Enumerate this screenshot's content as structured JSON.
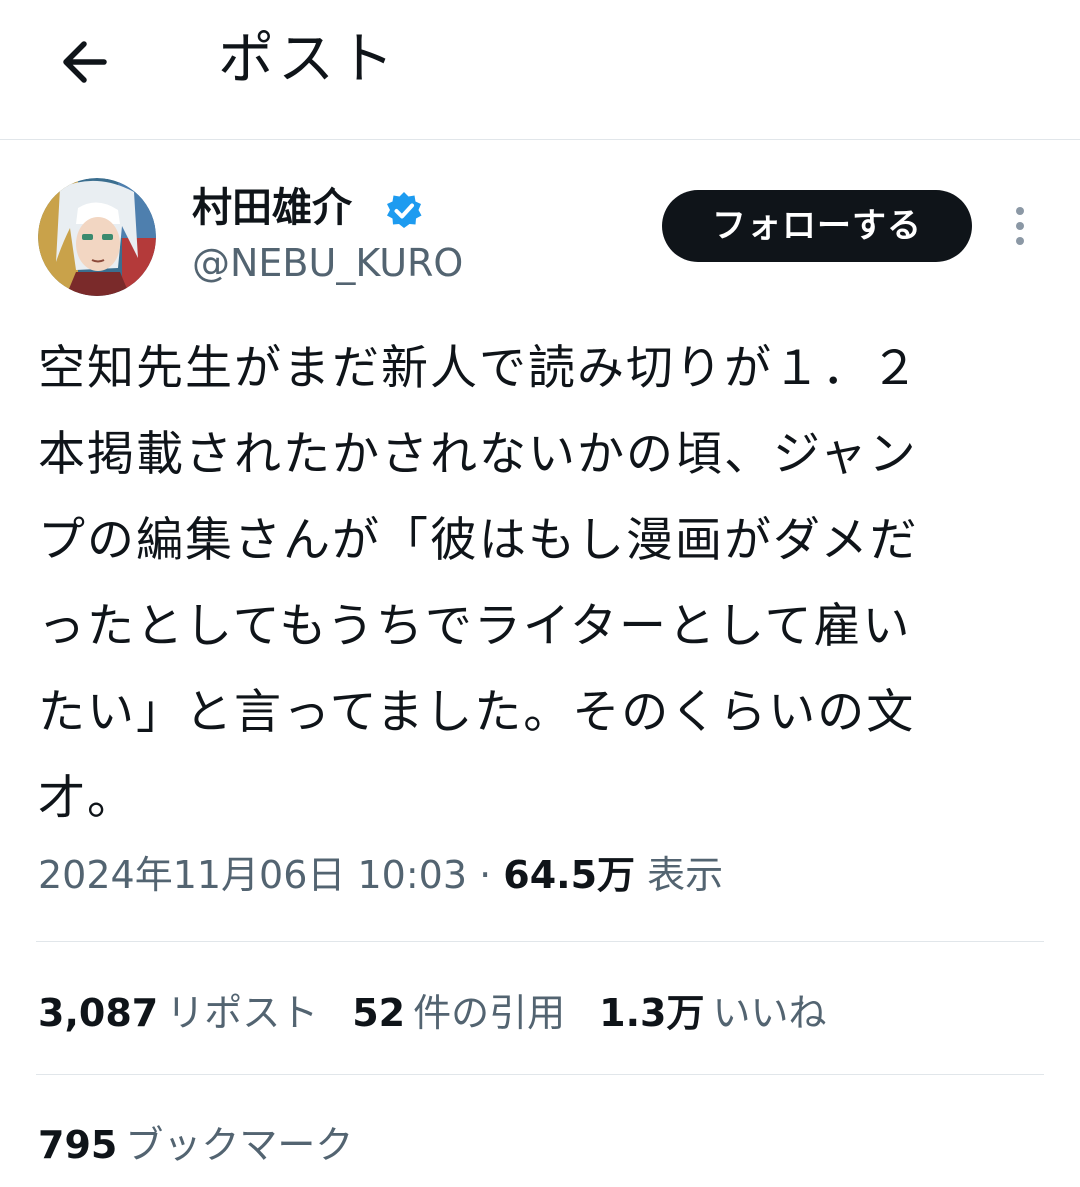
{
  "header": {
    "back_icon": "arrow-left-icon",
    "title": "ポスト"
  },
  "author": {
    "display_name": "村田雄介",
    "handle": "@NEBU_KURO",
    "verified": true,
    "verified_icon": "verified-badge-icon",
    "avatar_icon": "avatar-anime-character",
    "badge_color": "#1d9bf0"
  },
  "actions": {
    "follow_label": "フォローする",
    "more_icon": "more-vertical-icon"
  },
  "tweet": {
    "lines": [
      "空知先生がまだ新人で読み切りが１．２",
      "本掲載されたかされないかの頃、ジャン",
      "プの編集さんが「彼はもし漫画がダメだ",
      "ったとしてもうちでライターとして雇い",
      "たい」と言ってました。そのくらいの文",
      "才。"
    ]
  },
  "meta": {
    "timestamp": "2024年11月06日 10:03",
    "separator": "·",
    "views_count": "64.5万",
    "views_label": "表示"
  },
  "stats": {
    "reposts_count": "3,087",
    "reposts_label": "リポスト",
    "quotes_count": "52",
    "quotes_label": "件の引用",
    "likes_count": "1.3万",
    "likes_label": "いいね",
    "bookmarks_count": "795",
    "bookmarks_label": "ブックマーク"
  }
}
